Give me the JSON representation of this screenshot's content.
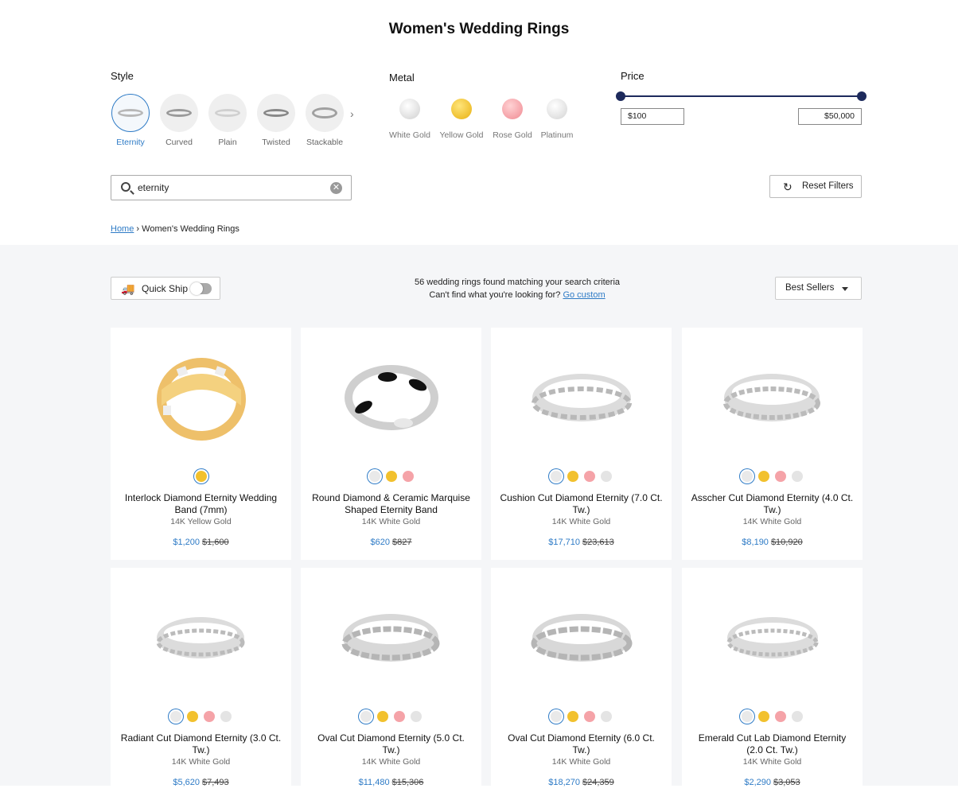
{
  "page_title": "Women's Wedding Rings",
  "filters": {
    "style": {
      "label": "Style",
      "items": [
        {
          "label": "Eternity",
          "active": true
        },
        {
          "label": "Curved",
          "active": false
        },
        {
          "label": "Plain",
          "active": false
        },
        {
          "label": "Twisted",
          "active": false
        },
        {
          "label": "Stackable",
          "active": false
        }
      ],
      "next_icon": "chevron-right-icon"
    },
    "metal": {
      "label": "Metal",
      "items": [
        {
          "label": "White Gold",
          "color": "#d9d9d9"
        },
        {
          "label": "Yellow Gold",
          "color": "#f2c12e"
        },
        {
          "label": "Rose Gold",
          "color": "#f5a3a8"
        },
        {
          "label": "Platinum",
          "color": "#dcdcdc"
        }
      ]
    },
    "price": {
      "label": "Price",
      "min_value": "$100",
      "max_value": "$50,000"
    }
  },
  "search": {
    "value": "eternity",
    "icon": "search-icon",
    "clear_icon": "clear-icon"
  },
  "reset_filters": {
    "label": "Reset Filters",
    "icon": "refresh-icon"
  },
  "breadcrumb": {
    "home": "Home",
    "separator": "›",
    "current": "Women's Wedding Rings"
  },
  "toolbar": {
    "quick_ship_label": "Quick Ship",
    "quick_ship_on": false,
    "results_text": "56 wedding rings found matching your search criteria",
    "custom_prompt": "Can't find what you're looking for?",
    "custom_link": "Go custom",
    "sort_label": "Best Sellers"
  },
  "colors": {
    "accent": "#2e7bc6",
    "navy": "#1d2a5c",
    "yellow_gold": "#f2c12e",
    "rose_gold": "#f5a3a8",
    "white_gold": "#d9d9d9"
  },
  "products": [
    {
      "name": "Interlock Diamond Eternity Wedding Band (7mm)",
      "metal": "14K Yellow Gold",
      "price": "$1,200",
      "was": "$1,600",
      "swatches": [
        "yellow"
      ],
      "selected": 0
    },
    {
      "name": "Round Diamond & Ceramic Marquise Shaped Eternity Band",
      "metal": "14K White Gold",
      "price": "$620",
      "was": "$827",
      "swatches": [
        "white",
        "yellow",
        "rose"
      ],
      "selected": 0
    },
    {
      "name": "Cushion Cut Diamond Eternity (7.0 Ct. Tw.)",
      "metal": "14K White Gold",
      "price": "$17,710",
      "was": "$23,613",
      "swatches": [
        "white",
        "yellow",
        "rose",
        "platinum"
      ],
      "selected": 0
    },
    {
      "name": "Asscher Cut Diamond Eternity (4.0 Ct. Tw.)",
      "metal": "14K White Gold",
      "price": "$8,190",
      "was": "$10,920",
      "swatches": [
        "white",
        "yellow",
        "rose",
        "platinum"
      ],
      "selected": 0
    },
    {
      "name": "Radiant Cut Diamond Eternity (3.0 Ct. Tw.)",
      "metal": "14K White Gold",
      "price": "$5,620",
      "was": "$7,493",
      "swatches": [
        "white",
        "yellow",
        "rose",
        "platinum"
      ],
      "selected": 0
    },
    {
      "name": "Oval Cut Diamond Eternity (5.0 Ct. Tw.)",
      "metal": "14K White Gold",
      "price": "$11,480",
      "was": "$15,306",
      "swatches": [
        "white",
        "yellow",
        "rose",
        "platinum"
      ],
      "selected": 0
    },
    {
      "name": "Oval Cut Diamond Eternity (6.0 Ct. Tw.)",
      "metal": "14K White Gold",
      "price": "$18,270",
      "was": "$24,359",
      "swatches": [
        "white",
        "yellow",
        "rose",
        "platinum"
      ],
      "selected": 0
    },
    {
      "name": "Emerald Cut Lab Diamond Eternity (2.0 Ct. Tw.)",
      "metal": "14K White Gold",
      "price": "$2,290",
      "was": "$3,053",
      "swatches": [
        "white",
        "yellow",
        "rose",
        "platinum"
      ],
      "selected": 0
    }
  ]
}
